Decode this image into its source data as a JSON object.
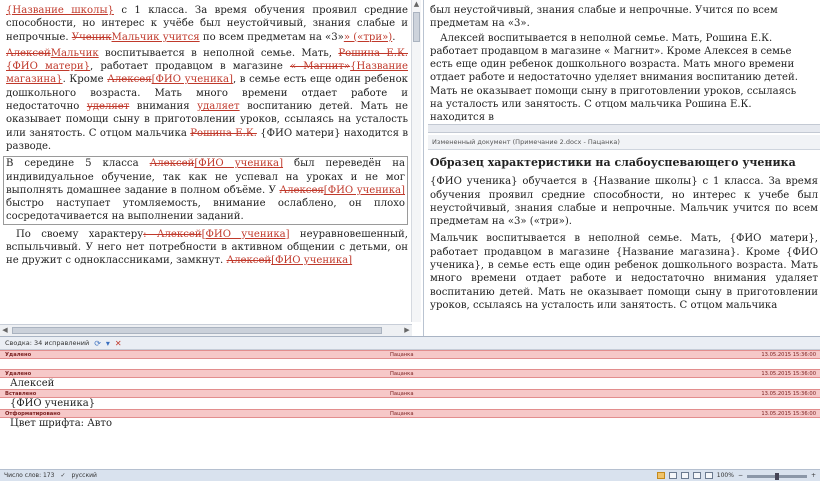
{
  "left_pane": {
    "p1": {
      "ins_school": "{Название школы}",
      "t1": " с 1 класса. За время обучения проявил средние способности, но интерес к учёбе был неустойчивый, знания слабые и непрочные. ",
      "del_uchenik": "Ученик",
      "ins_boy": "Мальчик учится",
      "t2": " по всем предметам на «3»",
      "ins_tri": "» («три»)",
      "t3": "."
    },
    "p2": {
      "del_aleksey": "Алексей",
      "ins_boy": "Мальчик",
      "t1": " воспитывается в неполной семье. Мать, ",
      "del_roshina": "Рошина Е.К.",
      "ins_fio_mother": "{ФИО матери}",
      "t2": ", работает продавцом в магазине ",
      "del_magnit": "« Магнит»",
      "ins_shop": "{Название магазина}",
      "t3": ". Кроме ",
      "del_alekseya": "Алексея",
      "ins_fio_student": "[ФИО ученика]",
      "t4": ", в семье есть еще один ребенок дошкольного возраста. Мать много времени отдает работе и недостаточно ",
      "del_udelyaet": "уделяет",
      "t5": " внимания ",
      "ins_udelyaet": "удаляет",
      "t6": " воспитанию детей. Мать не оказывает помощи сыну в приготовлении уроков, ссылаясь на усталость или занятость. С отцом мальчика ",
      "del_roshina2": "Рошина Е.К.",
      "t7": " {ФИО матери} находится в разводе."
    },
    "p3": {
      "t1": "В середине 5 класса ",
      "del_aleksey": "Алексей",
      "ins_fio_student": "[ФИО ученика]",
      "t2": " был переведён на индивидуальное обучение, так как не успевал на уроках и не мог выполнять домашнее задание в полном объёме. У ",
      "del_alekseya": "Алексея",
      "ins_fio_student2": "[ФИО ученика]",
      "t3": " быстро наступает утомляемость, внимание ослаблено, он плохо сосредотачивается на выполнении заданий."
    },
    "p4": {
      "t1": "По своему характеру",
      "del_aleksey_block": ": Алексей",
      "ins_fio_student": "[ФИО ученика]",
      "t2": " неуравновешенный, вспыльчивый. У него нет потребности в активном общении с детьми, он не дружит с одноклассниками, замкнут. ",
      "del_aleksey": "Алексей",
      "ins_fio_student2": "[ФИО ученика]"
    }
  },
  "right_pane": {
    "top_p1": "был неустойчивый, знания слабые и непрочные. Учится по всем предметам на «3».",
    "top_p2": "Алексей воспитывается в неполной семье. Мать, Рошина Е.К. работает продавцом в магазине « Магнит». Кроме Алексея в семье есть еще один ребенок дошкольного возраста. Мать много времени отдает работе и недостаточно уделяет внимания воспитанию детей. Мать не оказывает помощи сыну в приготовлении уроков, ссылаясь на усталость или занятость. С отцом мальчика Рошина Е.К. находится в",
    "caption": "Измененный документ (Примечание 2.docx - Пацанка)",
    "heading": "Образец характеристики на слабоуспевающего ученика",
    "bottom_p1": "{ФИО ученика} обучается в {Название школы} с 1 класса. За время обучения проявил средние способности, но интерес к учебе был неустойчивый, знания слабые и непрочные. Мальчик учится по всем предметам на «3» («три»).",
    "bottom_p2": "Мальчик воспитывается в неполной семье. Мать, {ФИО матери}, работает продавцом в магазине {Название магазина}. Кроме {ФИО ученика}, в семье есть еще один ребенок дошкольного возраста. Мать много времени отдает работе и недостаточно внимания удаляет воспитанию детей. Мать не оказывает помощи сыну в приготовлении уроков, ссылаясь на усталость или занятость. С отцом мальчика"
  },
  "review": {
    "toolbar_label": "Сводка: 34 исправлений",
    "icons": [
      "refresh-icon",
      "next-arrow-icon",
      "close-icon"
    ],
    "revisions": [
      {
        "type": "Удалено",
        "author": "Пацанка",
        "date": "13.05.2015 15:36:00",
        "content": ""
      },
      {
        "type": "Удалено",
        "author": "Пацанка",
        "date": "13.05.2015 15:36:00",
        "content": "Алексей"
      },
      {
        "type": "Вставлено",
        "author": "Пацанка",
        "date": "13.05.2015 15:36:00",
        "content": "{ФИО ученика}"
      },
      {
        "type": "Отформатировано",
        "author": "Пацанка",
        "date": "13.05.2015 15:36:00",
        "content": "Цвет шрифта: Авто"
      }
    ]
  },
  "statusbar": {
    "word_count": "Число слов: 173",
    "language": "русский",
    "zoom": "100%"
  },
  "colors": {
    "revision_red": "#c0392b",
    "revision_bar": "#f6c8c8",
    "statusbar_bg": "#d9e2ee"
  }
}
